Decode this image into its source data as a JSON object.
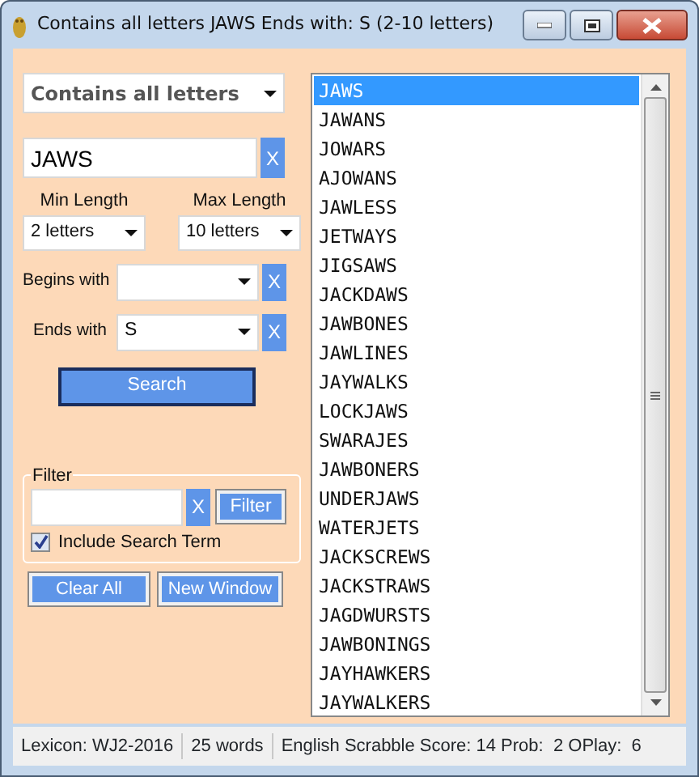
{
  "window": {
    "title": "Contains all letters JAWS Ends with: S (2-10 letters)"
  },
  "mode_dropdown": {
    "value": "Contains all letters"
  },
  "search_field": {
    "value": "JAWS",
    "clear": "X"
  },
  "min_length": {
    "label": "Min Length",
    "value": "2 letters"
  },
  "max_length": {
    "label": "Max Length",
    "value": "10 letters"
  },
  "begins_with": {
    "label": "Begins with",
    "clear": "X"
  },
  "ends_with": {
    "label": "Ends with",
    "value": "S",
    "clear": "X"
  },
  "search_button": "Search",
  "filter": {
    "legend": "Filter",
    "clear": "X",
    "button": "Filter",
    "include_search_term": {
      "label": "Include Search Term",
      "checked": true
    }
  },
  "buttons": [
    "Clear All",
    "New Window"
  ],
  "words": [
    {
      "text": "JAWS",
      "selected": true
    },
    {
      "text": "JAWANS",
      "selected": false
    },
    {
      "text": "JOWARS",
      "selected": false
    },
    {
      "text": "AJOWANS",
      "selected": false
    },
    {
      "text": "JAWLESS",
      "selected": false
    },
    {
      "text": "JETWAYS",
      "selected": false
    },
    {
      "text": "JIGSAWS",
      "selected": false
    },
    {
      "text": "JACKDAWS",
      "selected": false
    },
    {
      "text": "JAWBONES",
      "selected": false
    },
    {
      "text": "JAWLINES",
      "selected": false
    },
    {
      "text": "JAYWALKS",
      "selected": false
    },
    {
      "text": "LOCKJAWS",
      "selected": false
    },
    {
      "text": "SWARAJES",
      "selected": false
    },
    {
      "text": "JAWBONERS",
      "selected": false
    },
    {
      "text": "UNDERJAWS",
      "selected": false
    },
    {
      "text": "WATERJETS",
      "selected": false
    },
    {
      "text": "JACKSCREWS",
      "selected": false
    },
    {
      "text": "JACKSTRAWS",
      "selected": false
    },
    {
      "text": "JAGDWURSTS",
      "selected": false
    },
    {
      "text": "JAWBONINGS",
      "selected": false
    },
    {
      "text": "JAYHAWKERS",
      "selected": false
    },
    {
      "text": "JAYWALKERS",
      "selected": false
    }
  ],
  "status_bar": [
    "Lexicon: WJ2-2016",
    "25 words",
    "English Scrabble Score: 14 Prob:  2 OPlay:  6"
  ]
}
